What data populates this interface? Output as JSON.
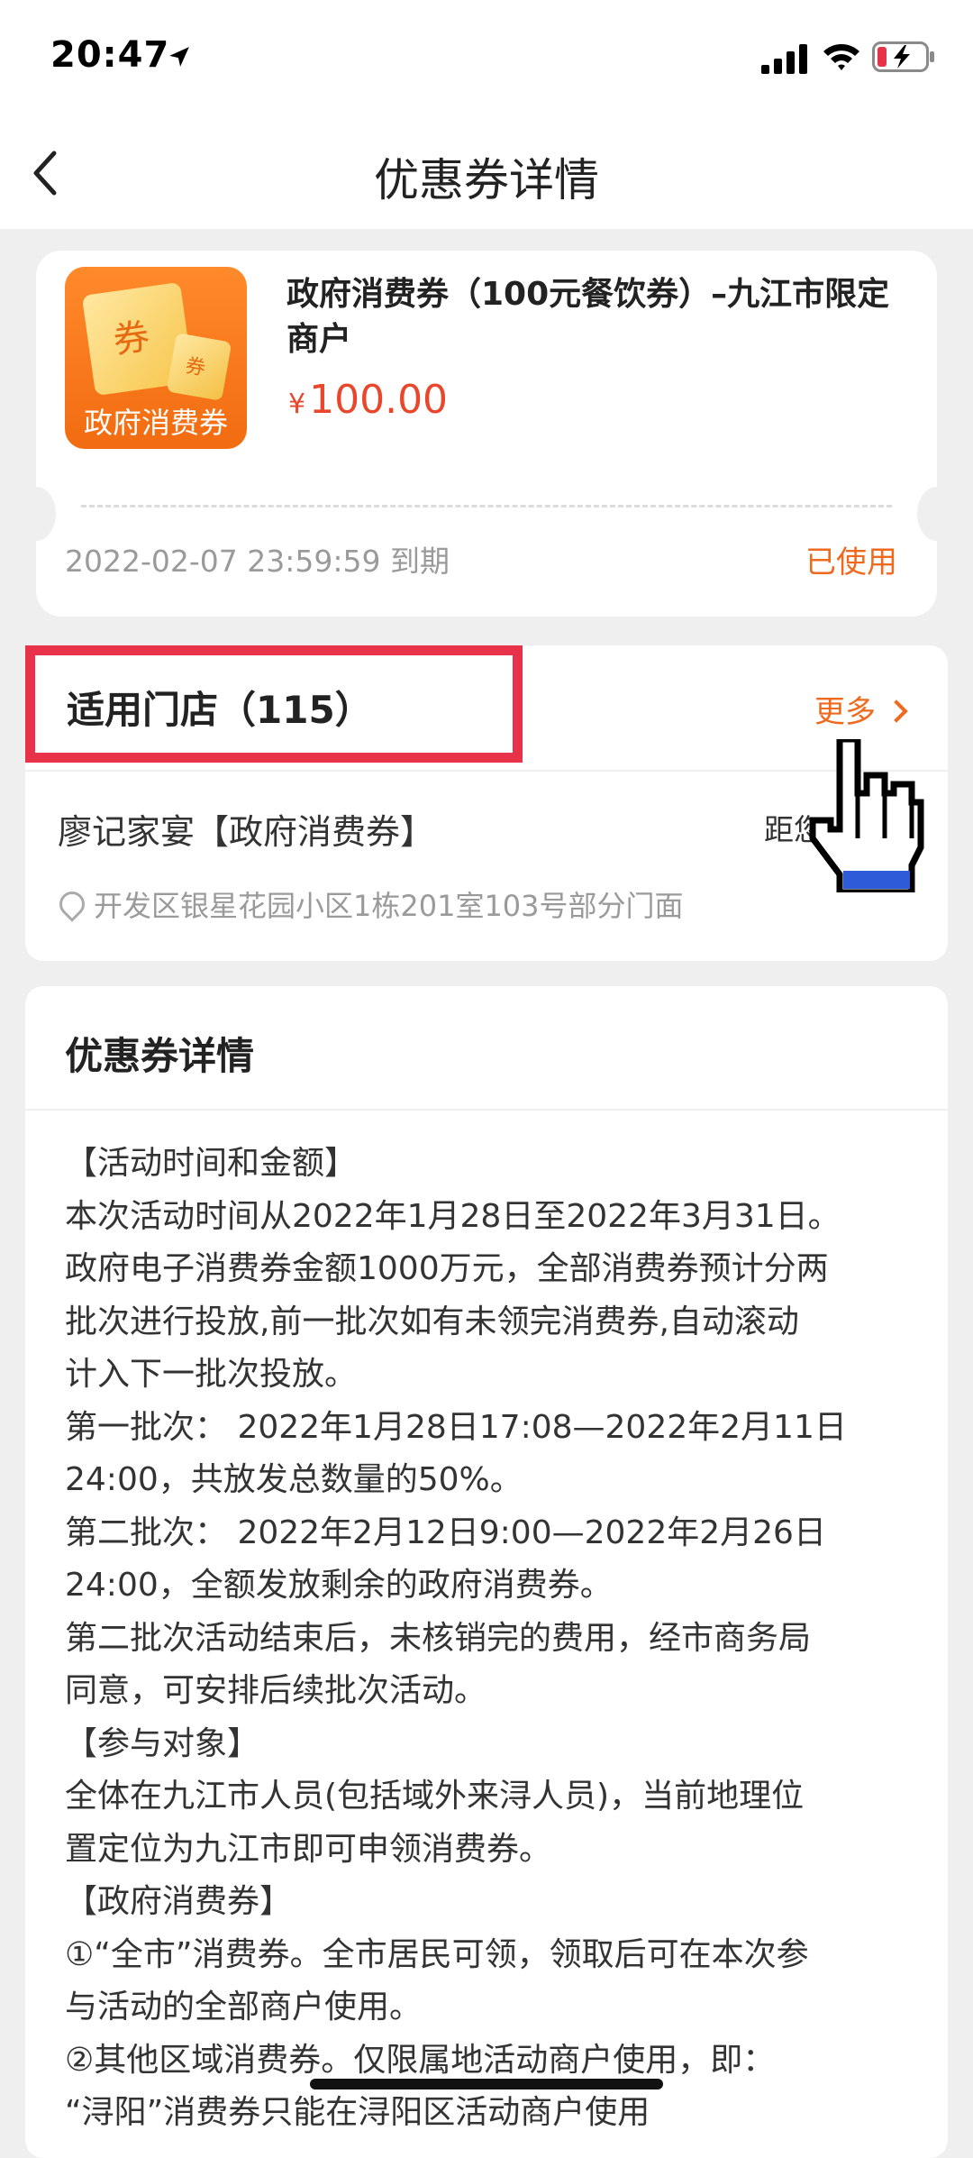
{
  "status_bar": {
    "time": "20:47"
  },
  "nav": {
    "title": "优惠券详情"
  },
  "coupon": {
    "thumb_ticket_big": "券",
    "thumb_ticket_small": "券",
    "thumb_label": "政府消费券",
    "title": "政府消费券（100元餐饮券）–九江市限定商户",
    "currency": "¥",
    "price": "100.00",
    "expiry": "2022-02-07 23:59:59 到期",
    "status": "已使用"
  },
  "stores": {
    "title": "适用门店（115）",
    "more": "更多",
    "store_name": "廖记家宴【政府消费券】",
    "distance": "距您",
    "address": "开发区银星花园小区1栋201室103号部分门面"
  },
  "details": {
    "title": "优惠券详情",
    "lines": [
      "【活动时间和金额】",
      "本次活动时间从2022年1月28日至2022年3月31日。",
      "政府电子消费券金额1000万元，全部消费券预计分两",
      "批次进行投放,前一批次如有未领完消费券,自动滚动",
      "计入下一批次投放。",
      "第一批次：  2022年1月28日17:08—2022年2月11日",
      "24:00，共放发总数量的50%。",
      "第二批次：  2022年2月12日9:00—2022年2月26日",
      "24:00，全额发放剩余的政府消费券。",
      "第二批次活动结束后，未核销完的费用，经市商务局",
      "同意，可安排后续批次活动。",
      "【参与对象】",
      "全体在九江市人员(包括域外来浔人员)，当前地理位",
      "置定位为九江市即可申领消费券。",
      "【政府消费券】",
      "①“全市”消费券。全市居民可领，领取后可在本次参",
      "与活动的全部商户使用。",
      "②其他区域消费券。仅限属地活动商户使用，即：",
      "“浔阳”消费券只能在浔阳区活动商户使用"
    ]
  }
}
